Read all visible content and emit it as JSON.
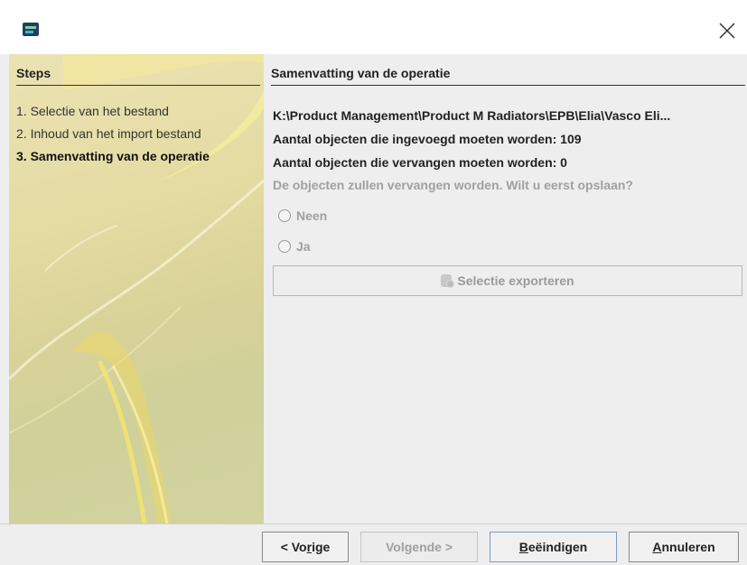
{
  "steps": {
    "title": "Steps",
    "items": [
      {
        "label": "1. Selectie van het bestand"
      },
      {
        "label": "2. Inhoud van het import bestand"
      },
      {
        "label": "3. Samenvatting van de operatie"
      }
    ]
  },
  "content": {
    "title": "Samenvatting van de operatie",
    "path": "K:\\Product Management\\Product M Radiators\\EPB\\Elia\\Vasco Eli...",
    "added": "Aantal objecten die ingevoegd moeten worden: 109",
    "replaced": "Aantal objecten die vervangen moeten worden: 0",
    "question": "De objecten zullen vervangen worden. Wilt u eerst opslaan?",
    "radio_no": "Neen",
    "radio_yes": "Ja",
    "export_label": "Selectie exporteren"
  },
  "buttons": {
    "prev": {
      "pre": "< Vo",
      "mn": "r",
      "post": "ige"
    },
    "next": {
      "pre": "Vol",
      "mn": "g",
      "post": "ende >"
    },
    "finish": {
      "pre": "",
      "mn": "B",
      "post": "eëindigen"
    },
    "cancel": {
      "pre": "",
      "mn": "A",
      "post": "nnuleren"
    }
  },
  "colors": {
    "steps_gradient": "#e4dba2",
    "disabled_text": "#a0a0a0",
    "panel_bg": "#eeeeee"
  }
}
